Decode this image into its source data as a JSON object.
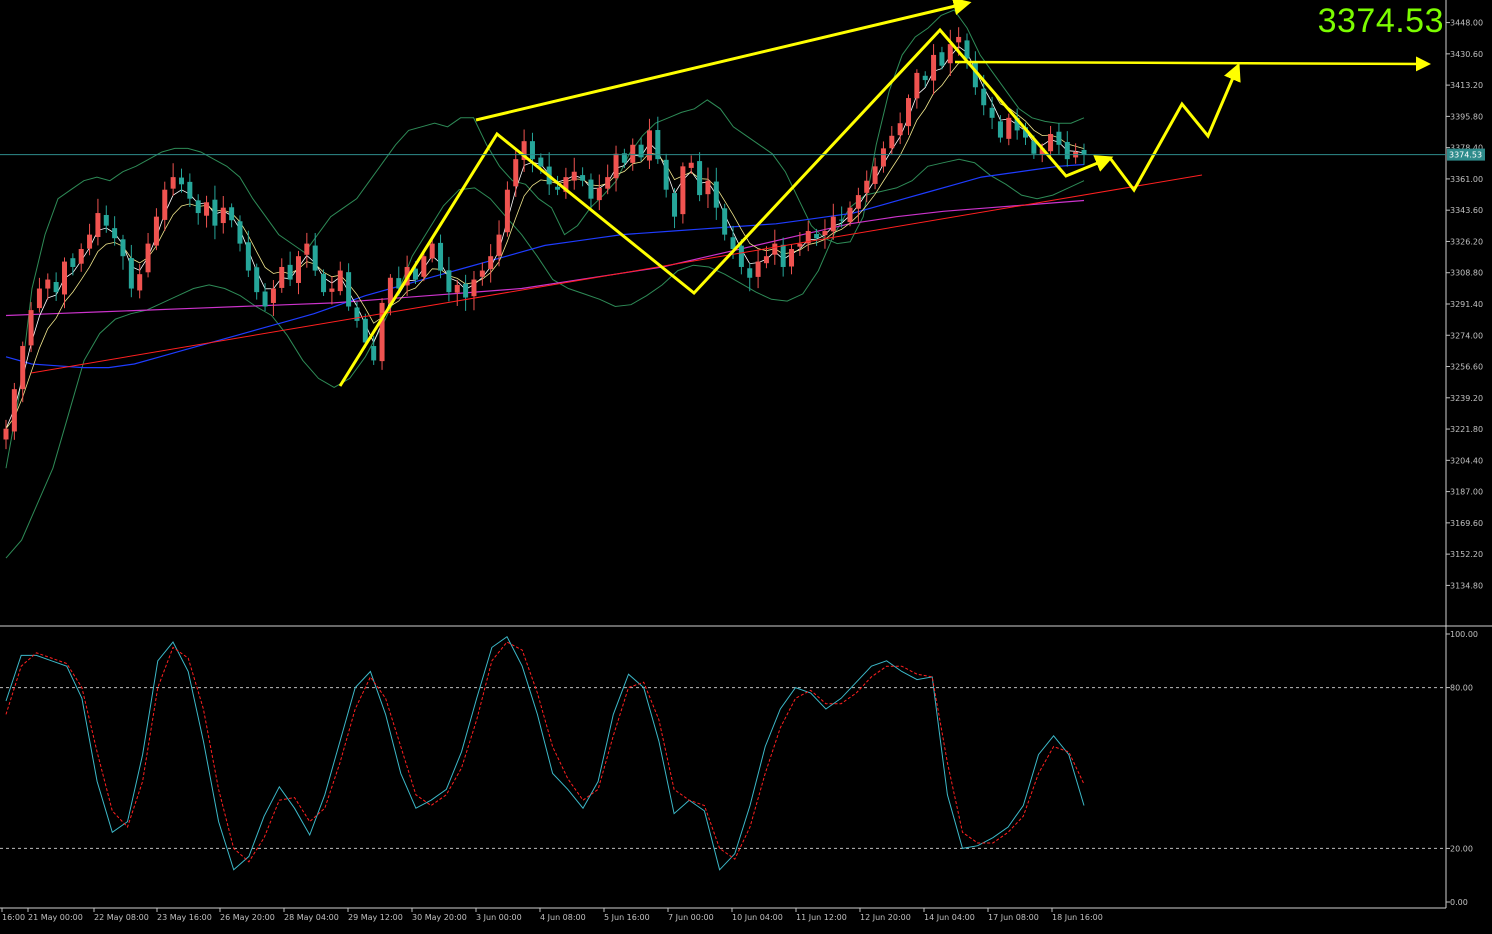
{
  "current_price": "3374.53",
  "price_tag": "3374.53",
  "colors": {
    "background": "#000000",
    "bull_candle": "#EF5350",
    "bear_candle": "#26A69A",
    "bollinger": "#2E8B57",
    "ema_fast": "#FFFFFF",
    "ema_mid": "#F0E68C",
    "ma_blue": "#1E3CFF",
    "ma_magenta": "#CC33CC",
    "trendline": "#FF2020",
    "annotation": "#FFFF00",
    "price_line": "#2E8B8B",
    "stoch_main": "#3CB8C8",
    "stoch_signal": "#FF2020",
    "big_price": "#7CFC00",
    "axis_text": "#C0C0C0"
  },
  "chart_data": {
    "type": "candlestick",
    "price_axis": {
      "min": 3120,
      "max": 3455,
      "ticks": [
        "3448.00",
        "3430.60",
        "3413.20",
        "3395.80",
        "3378.40",
        "3361.00",
        "3343.60",
        "3326.20",
        "3308.80",
        "3291.40",
        "3274.00",
        "3256.60",
        "3239.20",
        "3221.80",
        "3204.40",
        "3187.00",
        "3169.60",
        "3152.20",
        "3134.80"
      ]
    },
    "oscillator_axis": {
      "min": 0,
      "max": 100,
      "ticks": [
        "100.00",
        "80.00",
        "20.00",
        "0.00"
      ],
      "levels": [
        80,
        20
      ]
    },
    "time_labels": [
      "16:00",
      "21 May 00:00",
      "22 May 08:00",
      "23 May 16:00",
      "26 May 20:00",
      "28 May 04:00",
      "29 May 12:00",
      "30 May 20:00",
      "3 Jun 00:00",
      "4 Jun 08:00",
      "5 Jun 16:00",
      "7 Jun 00:00",
      "10 Jun 04:00",
      "11 Jun 12:00",
      "12 Jun 20:00",
      "14 Jun 04:00",
      "17 Jun 08:00",
      "18 Jun 16:00"
    ],
    "closes": [
      3222,
      3244,
      3268,
      3288,
      3300,
      3305,
      3298,
      3315,
      3312,
      3322,
      3330,
      3342,
      3335,
      3328,
      3318,
      3300,
      3308,
      3325,
      3340,
      3355,
      3362,
      3358,
      3350,
      3342,
      3348,
      3335,
      3345,
      3338,
      3325,
      3310,
      3298,
      3290,
      3300,
      3312,
      3305,
      3318,
      3325,
      3310,
      3298,
      3300,
      3310,
      3290,
      3282,
      3270,
      3260,
      3292,
      3306,
      3300,
      3312,
      3305,
      3318,
      3325,
      3310,
      3298,
      3302,
      3295,
      3305,
      3310,
      3318,
      3330,
      3355,
      3372,
      3382,
      3372,
      3368,
      3358,
      3355,
      3362,
      3365,
      3360,
      3350,
      3356,
      3362,
      3375,
      3370,
      3380,
      3373,
      3388,
      3372,
      3355,
      3340,
      3368,
      3370,
      3352,
      3360,
      3345,
      3330,
      3322,
      3312,
      3306,
      3315,
      3318,
      3325,
      3312,
      3322,
      3325,
      3332,
      3328,
      3332,
      3340,
      3338,
      3345,
      3352,
      3360,
      3368,
      3378,
      3385,
      3392,
      3406,
      3420,
      3416,
      3430,
      3424,
      3436,
      3440,
      3428,
      3412,
      3402,
      3395,
      3384,
      3395,
      3388,
      3384,
      3375,
      3378,
      3386,
      3380,
      3372,
      3376,
      3374.53
    ],
    "bb_upper": [
      3200,
      3240,
      3300,
      3330,
      3350,
      3355,
      3360,
      3362,
      3360,
      3365,
      3368,
      3372,
      3376,
      3378,
      3378,
      3376,
      3372,
      3368,
      3362,
      3350,
      3340,
      3330,
      3325,
      3320,
      3330,
      3340,
      3345,
      3350,
      3360,
      3370,
      3380,
      3388,
      3390,
      3392,
      3390,
      3395,
      3395,
      3380,
      3368,
      3360,
      3358,
      3350,
      3345,
      3330,
      3335,
      3345,
      3352,
      3360,
      3375,
      3385,
      3392,
      3395,
      3398,
      3400,
      3405,
      3400,
      3390,
      3385,
      3380,
      3375,
      3365,
      3350,
      3335,
      3328,
      3325,
      3326,
      3340,
      3380,
      3410,
      3430,
      3440,
      3445,
      3452,
      3455,
      3445,
      3430,
      3420,
      3410,
      3400,
      3395,
      3393,
      3392,
      3392,
      3395
    ],
    "bb_lower": [
      3150,
      3160,
      3180,
      3200,
      3230,
      3260,
      3275,
      3283,
      3286,
      3288,
      3292,
      3296,
      3300,
      3302,
      3300,
      3296,
      3290,
      3285,
      3274,
      3260,
      3250,
      3245,
      3250,
      3262,
      3278,
      3296,
      3318,
      3332,
      3346,
      3355,
      3356,
      3350,
      3340,
      3330,
      3318,
      3305,
      3300,
      3297,
      3294,
      3290,
      3291,
      3296,
      3302,
      3310,
      3313,
      3312,
      3308,
      3303,
      3298,
      3294,
      3293,
      3297,
      3310,
      3330,
      3345,
      3352,
      3354,
      3356,
      3360,
      3368,
      3370,
      3372,
      3370,
      3363,
      3358,
      3352,
      3350,
      3352,
      3356,
      3360
    ],
    "ma_blue": [
      3262,
      3258,
      3257,
      3256,
      3256,
      3258,
      3262,
      3266,
      3270,
      3274,
      3278,
      3282,
      3286,
      3291,
      3296,
      3300,
      3304,
      3308,
      3312,
      3316,
      3320,
      3324,
      3326,
      3328,
      3330,
      3331,
      3332,
      3333,
      3334,
      3335,
      3336,
      3338,
      3340,
      3342,
      3346,
      3350,
      3354,
      3358,
      3362,
      3364,
      3366,
      3368,
      3369
    ],
    "ma_magenta": [
      3285,
      3286,
      3287,
      3288,
      3289,
      3290,
      3291,
      3292,
      3294,
      3296,
      3298,
      3300,
      3304,
      3308,
      3312,
      3318,
      3324,
      3330,
      3336,
      3340,
      3343,
      3345,
      3347,
      3349
    ],
    "trendline": {
      "from": [
        3,
        3253
      ],
      "to": [
        100,
        3361
      ]
    },
    "stoch_main": [
      75,
      92,
      92,
      90,
      88,
      76,
      45,
      26,
      30,
      55,
      90,
      97,
      86,
      60,
      30,
      12,
      17,
      32,
      43,
      35,
      25,
      40,
      60,
      80,
      86,
      70,
      48,
      35,
      38,
      42,
      56,
      76,
      95,
      99,
      88,
      70,
      48,
      42,
      35,
      45,
      70,
      85,
      80,
      60,
      33,
      38,
      34,
      12,
      18,
      36,
      58,
      72,
      80,
      78,
      72,
      76,
      82,
      88,
      90,
      86,
      83,
      84,
      40,
      20,
      21,
      24,
      28,
      36,
      55,
      62,
      55,
      36
    ],
    "stoch_signal": [
      70,
      88,
      93,
      91,
      89,
      80,
      56,
      34,
      28,
      45,
      80,
      95,
      91,
      72,
      42,
      20,
      15,
      24,
      38,
      39,
      30,
      35,
      52,
      72,
      84,
      76,
      58,
      40,
      36,
      40,
      50,
      68,
      90,
      97,
      94,
      78,
      58,
      46,
      38,
      42,
      62,
      80,
      82,
      68,
      42,
      38,
      36,
      20,
      16,
      28,
      48,
      65,
      76,
      79,
      74,
      74,
      78,
      84,
      88,
      88,
      85,
      84,
      52,
      26,
      22,
      22,
      26,
      32,
      48,
      58,
      56,
      44
    ]
  }
}
